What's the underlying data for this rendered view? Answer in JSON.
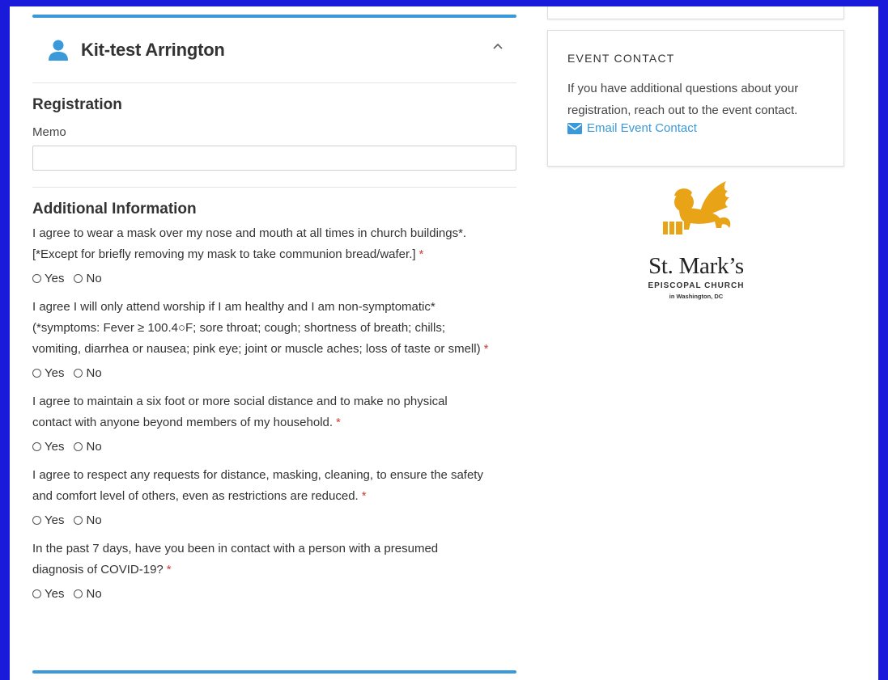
{
  "attendee": {
    "name": "Kit-test Arrington"
  },
  "registration": {
    "title": "Registration",
    "memo_label": "Memo",
    "memo_value": "",
    "memo_placeholder": ""
  },
  "additional_info": {
    "title": "Additional Information",
    "required_mark": "*",
    "yes_label": "Yes",
    "no_label": "No",
    "questions": [
      {
        "line1": "I agree to wear a mask over my nose and mouth at all times in church buildings*.",
        "line2": "[*Except for briefly removing my mask to take communion bread/wafer.]",
        "line3": ""
      },
      {
        "line1": "I agree I will only attend worship if I am healthy and I am non-symptomatic*",
        "line2": "(*symptoms: Fever ≥ 100.4○F; sore throat; cough; shortness of breath; chills;",
        "line3": "vomiting, diarrhea or nausea; pink eye; joint or muscle aches; loss of taste or smell)"
      },
      {
        "line1": "I agree to maintain a six foot or more social distance and to make no physical",
        "line2": "contact with anyone beyond members of my household.",
        "line3": ""
      },
      {
        "line1": "I agree to respect any requests for distance, masking, cleaning, to ensure the safety",
        "line2": "and comfort level of others, even as restrictions are reduced.",
        "line3": ""
      },
      {
        "line1": "In the past 7 days, have you been in contact with a person with a presumed",
        "line2": "diagnosis of COVID-19?",
        "line3": ""
      }
    ]
  },
  "event_contact": {
    "title": "EVENT CONTACT",
    "line1": "If you have additional questions about your",
    "line2": "registration, reach out to the event contact.",
    "email_label": "Email Event Contact"
  },
  "logo": {
    "name": "St. Mark’s",
    "subtitle": "EPISCOPAL CHURCH",
    "location": "in Washington, DC"
  },
  "colors": {
    "accent": "#3a9ad9",
    "frame": "#1a1adb",
    "required": "#d23a3a",
    "logo_gold": "#e8a317"
  },
  "icons": {
    "person": "person-icon",
    "collapse": "chevron-up-icon",
    "email": "envelope-icon",
    "logo_mark": "winged-lion-icon"
  }
}
